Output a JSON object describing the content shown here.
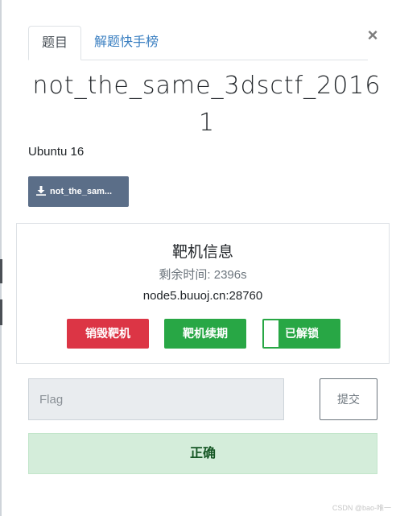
{
  "tabs": [
    {
      "label": "题目",
      "active": true
    },
    {
      "label": "解题快手榜",
      "active": false
    }
  ],
  "close_label": "×",
  "challenge": {
    "title": "not_the_same_3dsctf_2016 1",
    "subtitle": "Ubuntu 16",
    "download_label": "not_the_sam..."
  },
  "target": {
    "heading": "靶机信息",
    "time_text": "剩余时间: 2396s",
    "host": "node5.buuoj.cn:28760",
    "buttons": {
      "destroy": "销毁靶机",
      "renew": "靶机续期",
      "unlocked": "已解锁"
    }
  },
  "flag_form": {
    "placeholder": "Flag",
    "value": "",
    "submit_label": "提交"
  },
  "result": {
    "message": "正确"
  },
  "watermark": "CSDN @bao-唯一",
  "colors": {
    "tab_link": "#3a7fc1",
    "download_button": "#5b6e88",
    "danger": "#dc3545",
    "success": "#28a745",
    "alert_success_bg": "#d4edda",
    "alert_success_text": "#155724"
  },
  "icons": {
    "download": "download-icon",
    "close": "close-icon"
  }
}
